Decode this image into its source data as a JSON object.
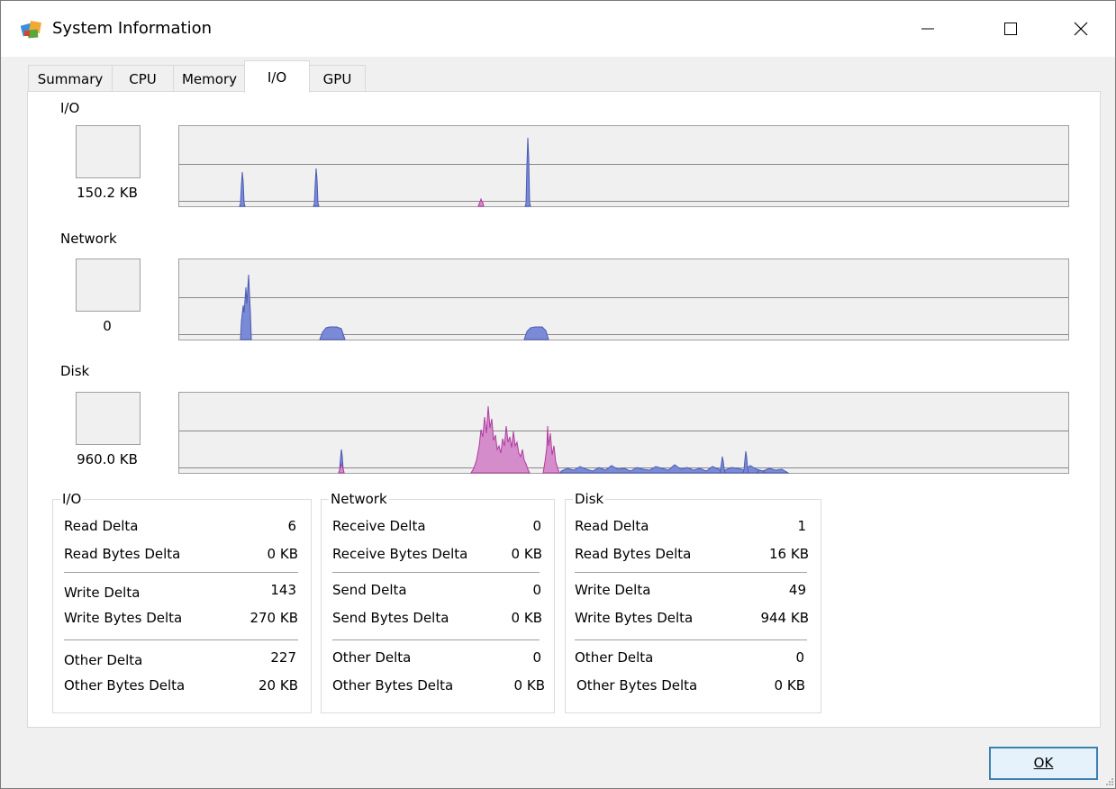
{
  "window": {
    "title": "System Information",
    "controls": {
      "minimize": "—",
      "maximize": "☐",
      "close": "✕"
    }
  },
  "tabs": [
    {
      "label": "Summary",
      "active": false
    },
    {
      "label": "CPU",
      "active": false
    },
    {
      "label": "Memory",
      "active": false
    },
    {
      "label": "I/O",
      "active": true
    },
    {
      "label": "GPU",
      "active": false
    }
  ],
  "graphs": {
    "io": {
      "label": "I/O",
      "value": "150.2 KB"
    },
    "network": {
      "label": "Network",
      "value": "0"
    },
    "disk": {
      "label": "Disk",
      "value": "960.0 KB"
    }
  },
  "colors": {
    "series_primary": "#4a5bb5",
    "series_primary_fill": "#7b8ad6",
    "series_secondary": "#b03ca0",
    "series_secondary_fill": "#d48ccb",
    "button_accent": "#3c7fb1"
  },
  "stats": {
    "io": {
      "title": "I/O",
      "rows": [
        {
          "label": "Read Delta",
          "value": "6"
        },
        {
          "label": "Read Bytes Delta",
          "value": "0 KB"
        },
        {
          "label": "Write Delta",
          "value": "143"
        },
        {
          "label": "Write Bytes Delta",
          "value": "270 KB"
        },
        {
          "label": "Other Delta",
          "value": "227"
        },
        {
          "label": "Other Bytes Delta",
          "value": "20 KB"
        }
      ]
    },
    "network": {
      "title": "Network",
      "rows": [
        {
          "label": "Receive Delta",
          "value": "0"
        },
        {
          "label": "Receive Bytes Delta",
          "value": "0 KB"
        },
        {
          "label": "Send Delta",
          "value": "0"
        },
        {
          "label": "Send Bytes Delta",
          "value": "0 KB"
        },
        {
          "label": "Other Delta",
          "value": "0"
        },
        {
          "label": "Other Bytes Delta",
          "value": "0 KB"
        }
      ]
    },
    "disk": {
      "title": "Disk",
      "rows": [
        {
          "label": "Read Delta",
          "value": "1"
        },
        {
          "label": "Read Bytes Delta",
          "value": "16 KB"
        },
        {
          "label": "Write Delta",
          "value": "49"
        },
        {
          "label": "Write Bytes Delta",
          "value": "944 KB"
        },
        {
          "label": "Other Delta",
          "value": "0"
        },
        {
          "label": "Other Bytes Delta",
          "value": "0 KB"
        }
      ]
    }
  },
  "footer": {
    "ok_label": "OK"
  }
}
